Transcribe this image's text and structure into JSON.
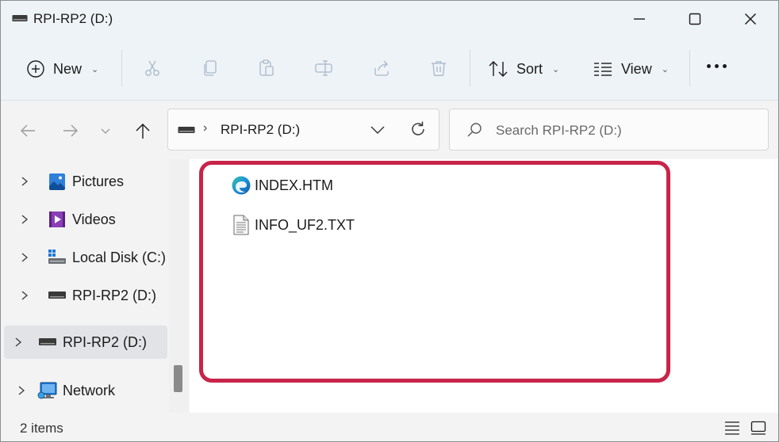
{
  "window": {
    "title": "RPI-RP2 (D:)"
  },
  "commandbar": {
    "new_label": "New",
    "sort_label": "Sort",
    "view_label": "View"
  },
  "navbar": {
    "address_text": "RPI-RP2 (D:)",
    "search_placeholder": "Search RPI-RP2 (D:)"
  },
  "sidebar": {
    "items": [
      {
        "label": "Pictures",
        "icon": "pictures-icon"
      },
      {
        "label": "Videos",
        "icon": "videos-icon"
      },
      {
        "label": "Local Disk (C:)",
        "icon": "local-disk-icon"
      },
      {
        "label": "RPI-RP2 (D:)",
        "icon": "drive-icon"
      },
      {
        "label": "RPI-RP2 (D:)",
        "icon": "drive-icon",
        "selected": true
      },
      {
        "label": "Network",
        "icon": "network-icon"
      }
    ]
  },
  "files": [
    {
      "name": "INDEX.HTM",
      "icon": "edge-html-icon"
    },
    {
      "name": "INFO_UF2.TXT",
      "icon": "text-file-icon"
    }
  ],
  "status": {
    "item_count": "2 items"
  },
  "colors": {
    "highlight": "#c8244a",
    "titlebar_bg": "#eef3f8",
    "content_bg": "#ffffff"
  }
}
